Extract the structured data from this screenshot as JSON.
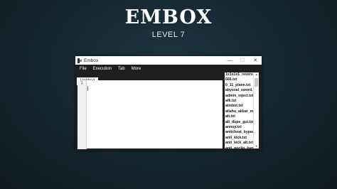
{
  "hero": {
    "title": "EMBOX",
    "subtitle": "LEVEL 7"
  },
  "window": {
    "title": "Embox",
    "controls": {
      "minimize": "—",
      "maximize": "☐",
      "close": "✕"
    }
  },
  "menu": [
    "File",
    "Execution",
    "Tab",
    "More"
  ],
  "tabs": [
    {
      "label": "Untitled"
    }
  ],
  "editor": {
    "line_numbers": [
      "1"
    ],
    "content": ""
  },
  "file_list": [
    "1x1x1x1_reversed",
    "666.txt",
    "0_11_plane.txt",
    "abyssal_sword.txt",
    "admin_inject.txt",
    "afk.txt",
    "aimbot.txt",
    "allahu_akbar_m",
    "alt.txt",
    "alt_dupe_gui.txt",
    "annoy.txt",
    "anticheat_bypass",
    "anti_kick.txt",
    "anti_kick_alt.txt",
    "anti_noclip_byp"
  ],
  "icons": {
    "app": "embox-app-icon",
    "scroll_up": "▲",
    "scroll_down": "▼"
  },
  "colors": {
    "background": "#15252e",
    "window_dark": "#1e1e1e",
    "text_light": "#ffffff"
  }
}
